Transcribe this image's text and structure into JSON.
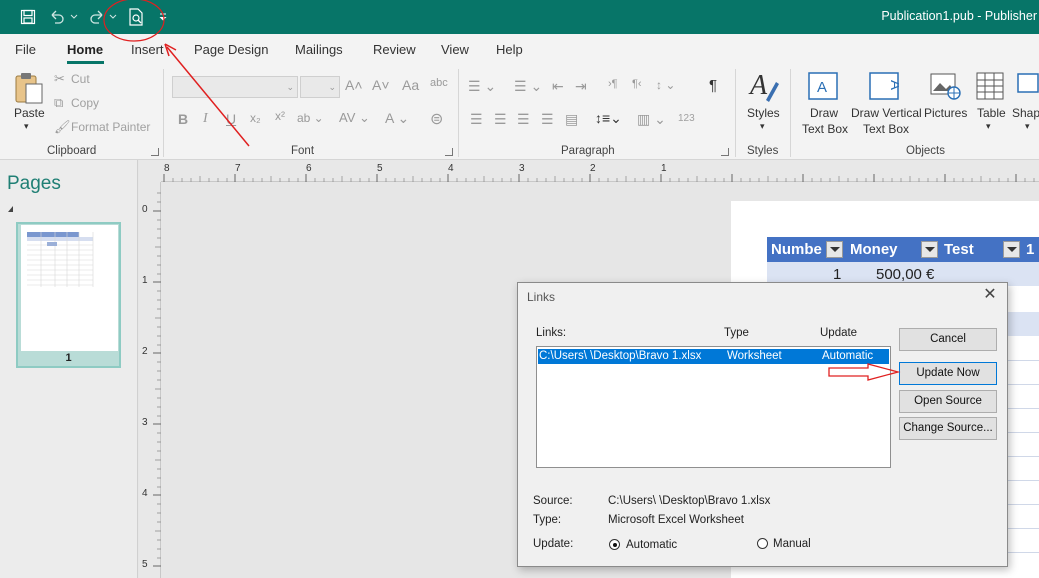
{
  "titlebar": {
    "document_title": "Publication1.pub - Publisher",
    "qat": {
      "save": "save-icon",
      "undo": "undo-icon",
      "redo": "redo-icon",
      "print_preview": "print-preview-icon",
      "customize": "customize-qat-icon"
    },
    "color": "#077568"
  },
  "tabs": [
    "File",
    "Home",
    "Insert",
    "Page Design",
    "Mailings",
    "Review",
    "View",
    "Help"
  ],
  "active_tab": "Home",
  "ribbon": {
    "clipboard": {
      "label": "Clipboard",
      "paste": "Paste",
      "cut": "Cut",
      "copy": "Copy",
      "format_painter": "Format Painter"
    },
    "font": {
      "label": "Font",
      "bold": "B",
      "italic": "I",
      "underline": "U"
    },
    "paragraph": {
      "label": "Paragraph",
      "pilcrow": "¶",
      "numbering": "123"
    },
    "styles": {
      "label": "Styles",
      "button": "Styles"
    },
    "objects": {
      "label": "Objects",
      "draw_text_box": [
        "Draw",
        "Text Box"
      ],
      "draw_vertical_text_box": [
        "Draw Vertical",
        "Text Box"
      ],
      "pictures": "Pictures",
      "table": "Table",
      "shapes": "Shap"
    }
  },
  "pages_pane": {
    "title": "Pages",
    "thumbnails": [
      {
        "number": "1"
      }
    ]
  },
  "rulers": {
    "horizontal": [
      "8",
      "7",
      "6",
      "5",
      "4",
      "3",
      "2",
      "1"
    ],
    "vertical": [
      "0",
      "1",
      "2",
      "3",
      "4",
      "5"
    ]
  },
  "excel_object": {
    "headers": [
      "Numbe",
      "Money",
      "Test",
      "1"
    ],
    "row1": [
      "1",
      "500,00 €"
    ],
    "header_color": "#4472c4",
    "band_color": "#dbe3f3"
  },
  "links_dialog": {
    "title": "Links",
    "columns": {
      "links": "Links:",
      "type": "Type",
      "update": "Update"
    },
    "rows": [
      {
        "path": "C:\\Users\\    \\Desktop\\Bravo 1.xlsx",
        "type": "Worksheet",
        "update": "Automatic"
      }
    ],
    "buttons": {
      "cancel": "Cancel",
      "update_now": "Update Now",
      "open_source": "Open Source",
      "change_source": "Change Source..."
    },
    "source_label": "Source:",
    "source_value": "C:\\Users\\    \\Desktop\\Bravo 1.xlsx",
    "type_label": "Type:",
    "type_value": "Microsoft Excel Worksheet",
    "update_label": "Update:",
    "update_options": [
      "Automatic",
      "Manual"
    ],
    "selected_update": "Automatic",
    "selection_color": "#0078d7"
  },
  "annotations": {
    "color": "#e02020"
  }
}
